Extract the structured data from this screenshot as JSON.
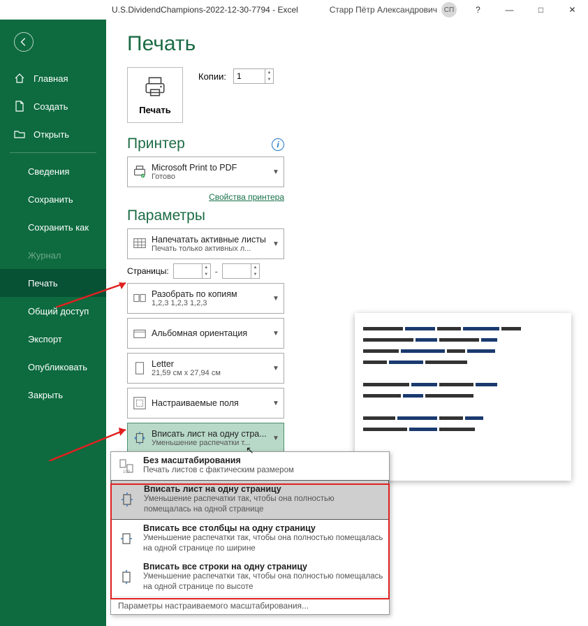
{
  "titlebar": {
    "doc": "U.S.DividendChampions-2022-12-30-7794 - Excel",
    "user": "Старр Пётр Александрович",
    "avatar": "СП",
    "help": "?",
    "min": "—",
    "max": "□",
    "close": "✕"
  },
  "sidebar": {
    "home": "Главная",
    "new": "Создать",
    "open": "Открыть",
    "info": "Сведения",
    "save": "Сохранить",
    "saveas": "Сохранить как",
    "history": "Журнал",
    "print": "Печать",
    "share": "Общий доступ",
    "export": "Экспорт",
    "publish": "Опубликовать",
    "close": "Закрыть"
  },
  "page": {
    "title": "Печать",
    "printBtn": "Печать",
    "copiesLabel": "Копии:",
    "copiesValue": "1",
    "printerHeader": "Принтер",
    "printerName": "Microsoft Print to PDF",
    "printerStatus": "Готово",
    "printerProps": "Свойства принтера",
    "paramsHeader": "Параметры",
    "activeSheets1": "Напечатать активные листы",
    "activeSheets2": "Печать только активных л...",
    "pagesLabel": "Страницы:",
    "collate1": "Разобрать по копиям",
    "collate2": "1,2,3    1,2,3    1,2,3",
    "orient1": "Альбомная ориентация",
    "size1": "Letter",
    "size2": "21,59 см x 27,94 см",
    "margins1": "Настраиваемые поля",
    "scale1": "Вписать лист на одну стра...",
    "scale2": "Уменьшение распечатки т..."
  },
  "popup": {
    "opt0t": "Без масштабирования",
    "opt0d": "Печать листов с фактическим размером",
    "opt1t": "Вписать лист на одну страницу",
    "opt1d": "Уменьшение распечатки так, чтобы она полностью помещалась на одной странице",
    "opt2t": "Вписать все столбцы на одну страницу",
    "opt2d": "Уменьшение распечатки так, чтобы она полностью помещалась на одной странице по ширине",
    "opt3t": "Вписать все строки на одну страницу",
    "opt3d": "Уменьшение распечатки так, чтобы она полностью помещалась на одной странице по высоте",
    "footer": "Параметры настраиваемого масштабирования..."
  }
}
